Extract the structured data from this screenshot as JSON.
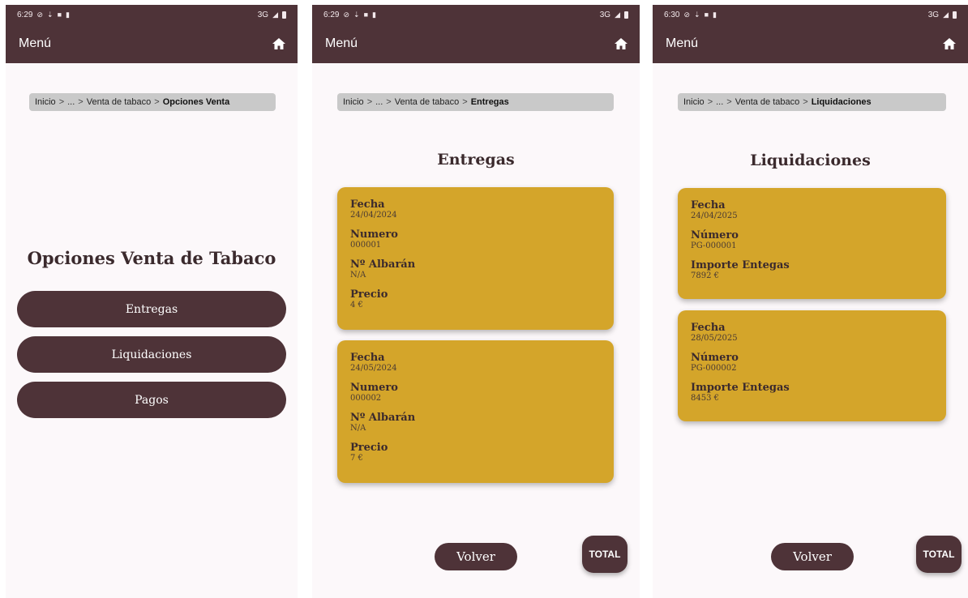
{
  "screens": [
    {
      "status": {
        "time": "6:29",
        "network": "3G"
      },
      "appbar": {
        "menu_label": "Menú"
      },
      "breadcrumb": {
        "home": "Inicio",
        "sep1": ">",
        "ellipsis": "...",
        "sep2": ">",
        "section": "Venta de tabaco",
        "sep3": ">",
        "current": "Opciones Venta"
      },
      "title": "Opciones Venta de Tabaco",
      "buttons": [
        "Entregas",
        "Liquidaciones",
        "Pagos"
      ]
    },
    {
      "status": {
        "time": "6:29",
        "network": "3G"
      },
      "appbar": {
        "menu_label": "Menú"
      },
      "breadcrumb": {
        "home": "Inicio",
        "sep1": ">",
        "ellipsis": "...",
        "sep2": ">",
        "section": "Venta de tabaco",
        "sep3": ">",
        "current": "Entregas"
      },
      "title": "Entregas",
      "cards": [
        {
          "fields": [
            {
              "label": "Fecha",
              "value": "24/04/2024"
            },
            {
              "label": "Numero",
              "value": "000001"
            },
            {
              "label": "Nº Albarán",
              "value": "N/A"
            },
            {
              "label": "Precio",
              "value": "4 €"
            }
          ]
        },
        {
          "fields": [
            {
              "label": "Fecha",
              "value": "24/05/2024"
            },
            {
              "label": "Numero",
              "value": "000002"
            },
            {
              "label": "Nº Albarán",
              "value": "N/A"
            },
            {
              "label": "Precio",
              "value": "7 €"
            }
          ]
        }
      ],
      "volver_label": "Volver",
      "total_label": "TOTAL"
    },
    {
      "status": {
        "time": "6:30",
        "network": "3G"
      },
      "appbar": {
        "menu_label": "Menú"
      },
      "breadcrumb": {
        "home": "Inicio",
        "sep1": ">",
        "ellipsis": "...",
        "sep2": ">",
        "section": "Venta de tabaco",
        "sep3": ">",
        "current": "Liquidaciones"
      },
      "title": "Liquidaciones",
      "cards": [
        {
          "fields": [
            {
              "label": "Fecha",
              "value": "24/04/2025"
            },
            {
              "label": "Número",
              "value": "PG-000001"
            },
            {
              "label": "Importe Entegas",
              "value": "7892 €"
            }
          ]
        },
        {
          "fields": [
            {
              "label": "Fecha",
              "value": "28/05/2025"
            },
            {
              "label": "Número",
              "value": "PG-000002"
            },
            {
              "label": "Importe Entegas",
              "value": "8453 €"
            }
          ]
        }
      ],
      "volver_label": "Volver",
      "total_label": "TOTAL"
    }
  ],
  "colors": {
    "appbar": "#4e3338",
    "card": "#d4a52a",
    "breadcrumb": "#c9c9c9",
    "background": "#fcf8fa"
  },
  "icons": {
    "home": "home-icon",
    "signal": "signal-icon",
    "battery": "battery-icon"
  }
}
